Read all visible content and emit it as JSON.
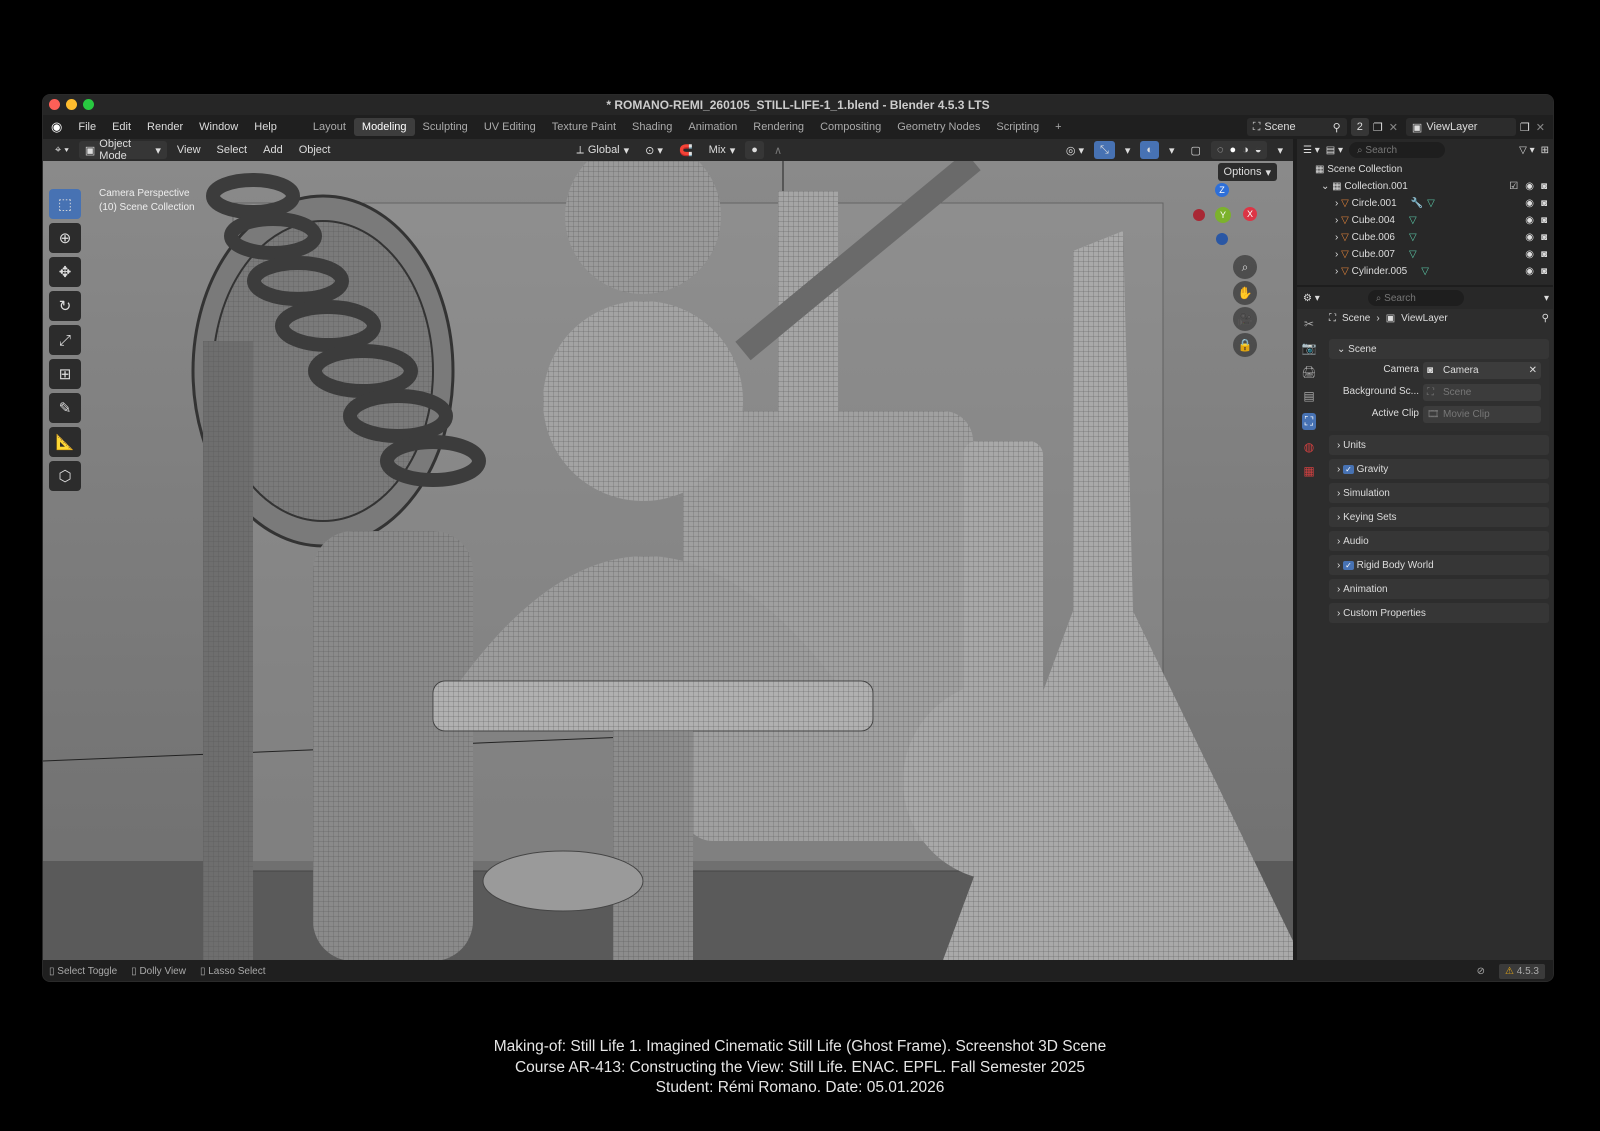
{
  "window": {
    "title": "* ROMANO-REMI_260105_STILL-LIFE-1_1.blend - Blender 4.5.3 LTS"
  },
  "menu": {
    "items": [
      "File",
      "Edit",
      "Render",
      "Window",
      "Help"
    ]
  },
  "workspaces": {
    "tabs": [
      "Layout",
      "Modeling",
      "Sculpting",
      "UV Editing",
      "Texture Paint",
      "Shading",
      "Animation",
      "Rendering",
      "Compositing",
      "Geometry Nodes",
      "Scripting"
    ],
    "active": "Modeling"
  },
  "topright": {
    "scene": "Scene",
    "users": "2",
    "viewlayer": "ViewLayer"
  },
  "viewport_header": {
    "mode": "Object Mode",
    "menus": [
      "View",
      "Select",
      "Add",
      "Object"
    ],
    "orientation": "Global",
    "mix": "Mix",
    "options": "Options"
  },
  "viewport": {
    "line1": "Camera Perspective",
    "line2": "(10) Scene Collection",
    "gizmo": {
      "z": "Z",
      "y": "Y",
      "x": "X"
    }
  },
  "outliner": {
    "search_placeholder": "Search",
    "root": "Scene Collection",
    "collection": "Collection.001",
    "objects": [
      "Circle.001",
      "Cube.004",
      "Cube.006",
      "Cube.007",
      "Cylinder.005"
    ]
  },
  "properties": {
    "search_placeholder": "Search",
    "breadcrumb_scene": "Scene",
    "breadcrumb_layer": "ViewLayer",
    "section": "Scene",
    "camera_label": "Camera",
    "camera_value": "Camera",
    "bg_label": "Background Sc...",
    "bg_value": "Scene",
    "clip_label": "Active Clip",
    "clip_value": "Movie Clip",
    "panels": [
      {
        "label": "Units",
        "checkbox": false
      },
      {
        "label": "Gravity",
        "checkbox": true
      },
      {
        "label": "Simulation",
        "checkbox": false
      },
      {
        "label": "Keying Sets",
        "checkbox": false
      },
      {
        "label": "Audio",
        "checkbox": false
      },
      {
        "label": "Rigid Body World",
        "checkbox": true
      },
      {
        "label": "Animation",
        "checkbox": false
      },
      {
        "label": "Custom Properties",
        "checkbox": false
      }
    ]
  },
  "statusbar": {
    "hints": [
      "Select Toggle",
      "Dolly View",
      "Lasso Select"
    ],
    "version": "4.5.3"
  },
  "caption": {
    "line1": "Making-of: Still Life 1. Imagined Cinematic Still Life (Ghost Frame). Screenshot 3D Scene",
    "line2": "Course AR-413: Constructing the View: Still Life. ENAC. EPFL. Fall Semester 2025",
    "line3": "Student: Rémi Romano. Date: 05.01.2026"
  },
  "colors": {
    "accent": "#4772b3",
    "object_orange": "#e0833a",
    "mesh_green": "#5cc9a8"
  }
}
